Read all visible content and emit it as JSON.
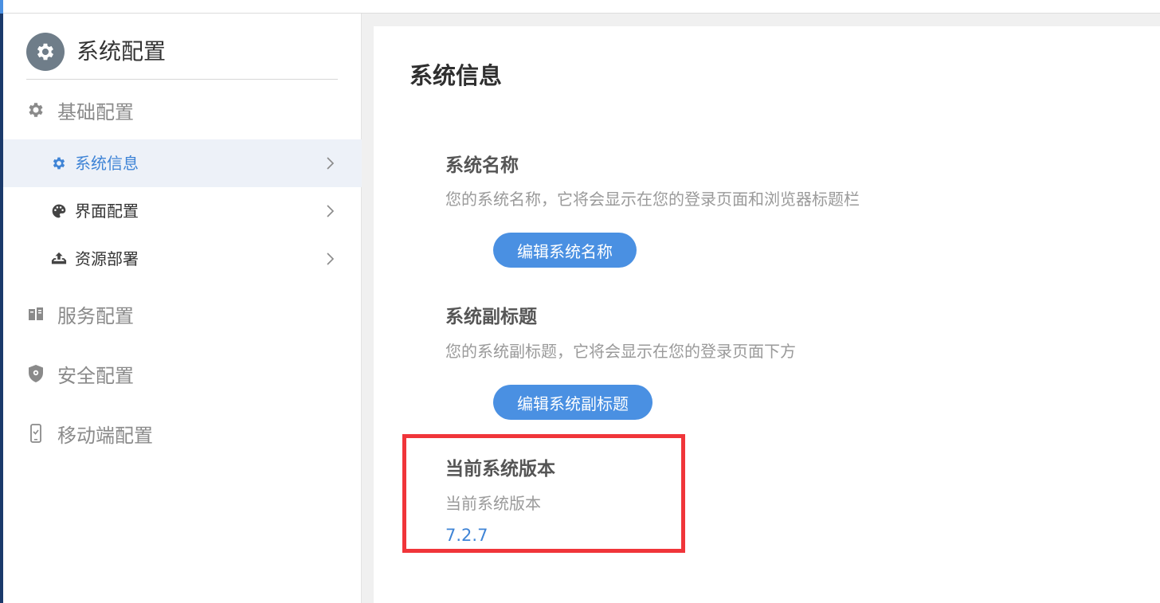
{
  "sidebar": {
    "title": "系统配置",
    "groups": [
      {
        "label": "基础配置",
        "icon": "gear-icon"
      },
      {
        "label": "服务配置",
        "icon": "server-icon"
      },
      {
        "label": "安全配置",
        "icon": "shield-icon"
      },
      {
        "label": "移动端配置",
        "icon": "mobile-icon"
      }
    ],
    "items": [
      {
        "label": "系统信息",
        "icon": "gear-icon",
        "active": true
      },
      {
        "label": "界面配置",
        "icon": "palette-icon",
        "active": false
      },
      {
        "label": "资源部署",
        "icon": "upload-tray-icon",
        "active": false
      }
    ]
  },
  "main": {
    "title": "系统信息",
    "sections": [
      {
        "title": "系统名称",
        "desc": "您的系统名称，它将会显示在您的登录页面和浏览器标题栏",
        "button": "编辑系统名称"
      },
      {
        "title": "系统副标题",
        "desc": "您的系统副标题，它将会显示在您的登录页面下方",
        "button": "编辑系统副标题"
      },
      {
        "title": "当前系统版本",
        "desc": "当前系统版本",
        "value": "7.2.7"
      }
    ]
  },
  "colors": {
    "accent": "#4a90e2",
    "active_text": "#3f84d6",
    "highlight": "#f0353a",
    "sidebar_active_bg": "#edf1f8"
  }
}
